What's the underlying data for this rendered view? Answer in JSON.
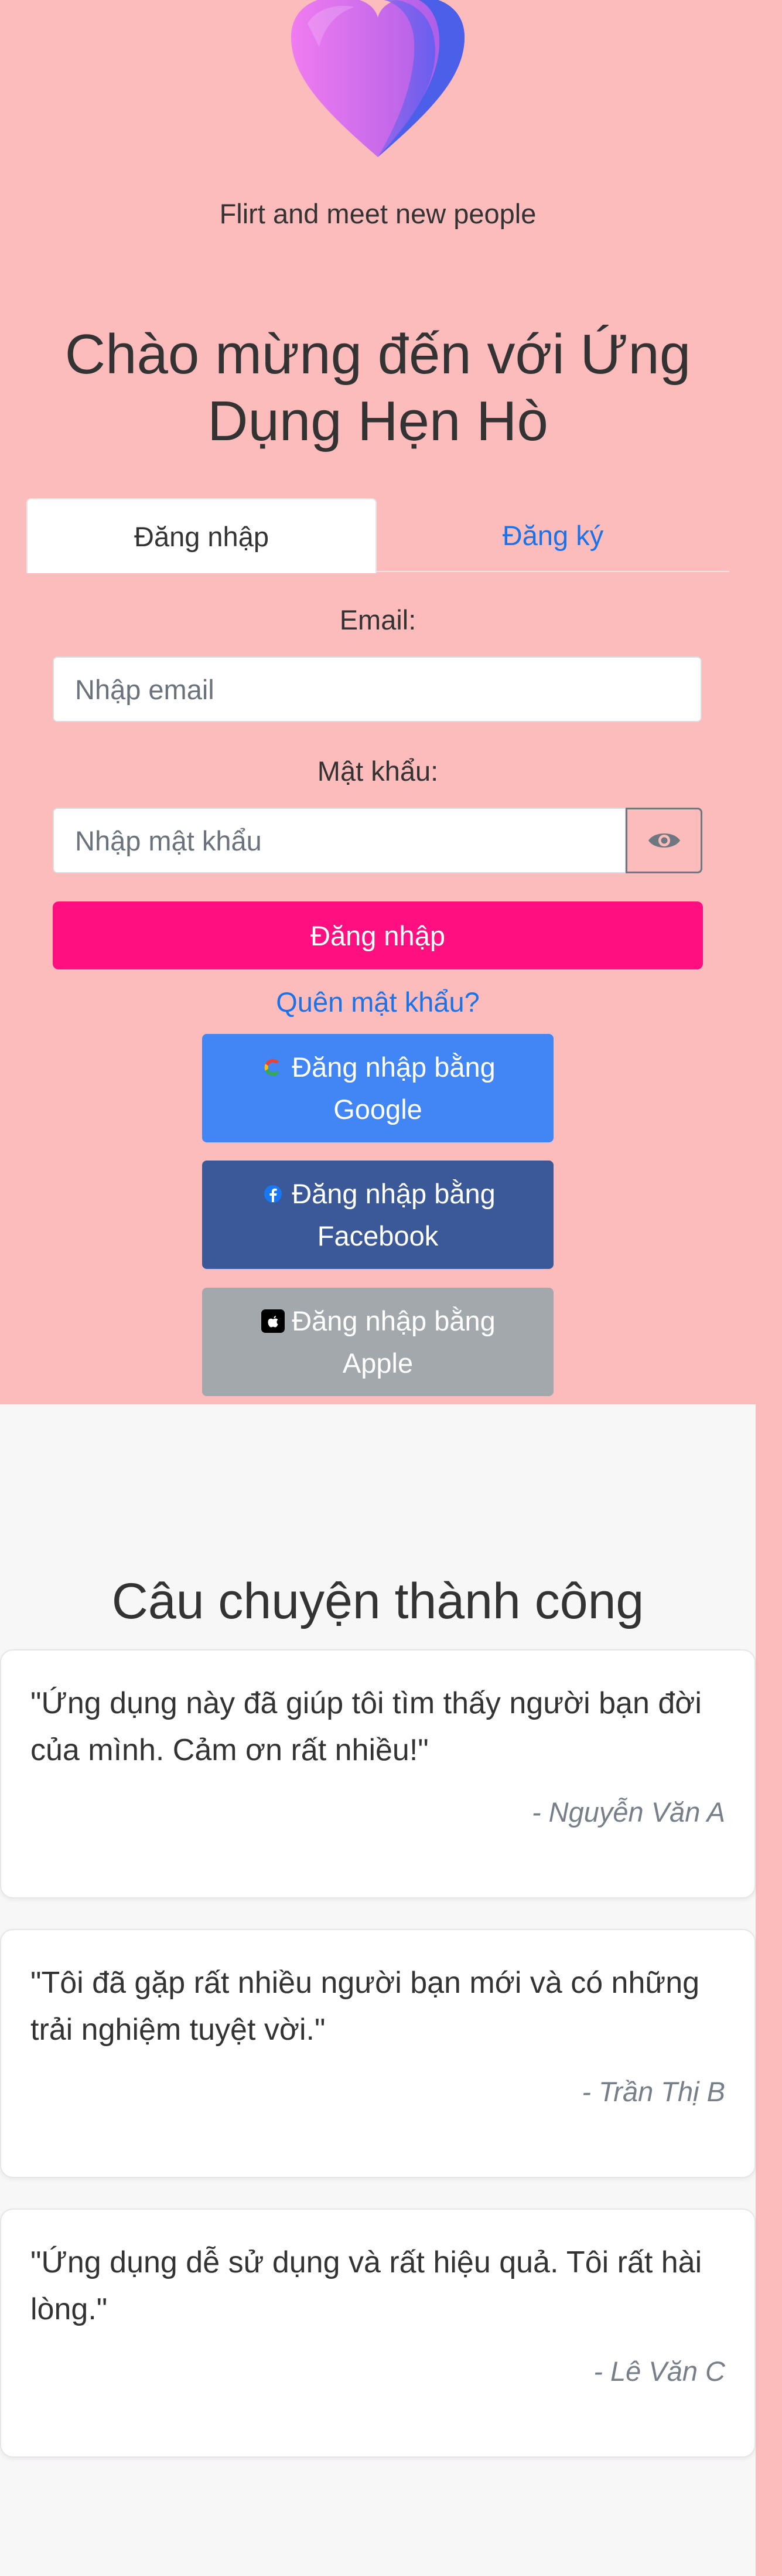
{
  "hero": {
    "tagline": "Flirt and meet new people",
    "welcome_title": "Chào mừng đến với Ứng Dụng Hẹn Hò"
  },
  "tabs": {
    "login": "Đăng nhập",
    "register": "Đăng ký"
  },
  "login_form": {
    "email_label": "Email:",
    "email_placeholder": "Nhập email",
    "password_label": "Mật khẩu:",
    "password_placeholder": "Nhập mật khẩu",
    "submit_label": "Đăng nhập",
    "forgot_label": "Quên mật khẩu?"
  },
  "social": {
    "google_line1": "Đăng nhập bằng",
    "google_line2": "Google",
    "facebook_line1": "Đăng nhập bằng",
    "facebook_line2": "Facebook",
    "apple_line1": "Đăng nhập bằng",
    "apple_line2": "Apple",
    "icons": [
      "google-icon",
      "facebook-icon",
      "apple-icon"
    ]
  },
  "testimonials": {
    "title": "Câu chuyện thành công",
    "items": [
      {
        "quote": "\"Ứng dụng này đã giúp tôi tìm thấy người bạn đời của mình. Cảm ơn rất nhiều!\"",
        "author": "- Nguyễn Văn A"
      },
      {
        "quote": "\"Tôi đã gặp rất nhiều người bạn mới và có những trải nghiệm tuyệt vời.\"",
        "author": "- Trần Thị B"
      },
      {
        "quote": "\"Ứng dụng dễ sử dụng và rất hiệu quả. Tôi rất hài lòng.\"",
        "author": "- Lê Văn C"
      }
    ]
  },
  "colors": {
    "hero_background": "#fdbcbc",
    "primary_button": "#ff0f80",
    "link": "#1a73e8",
    "google": "#4285f4",
    "facebook": "#3b5998",
    "apple": "#a3a8ac"
  }
}
